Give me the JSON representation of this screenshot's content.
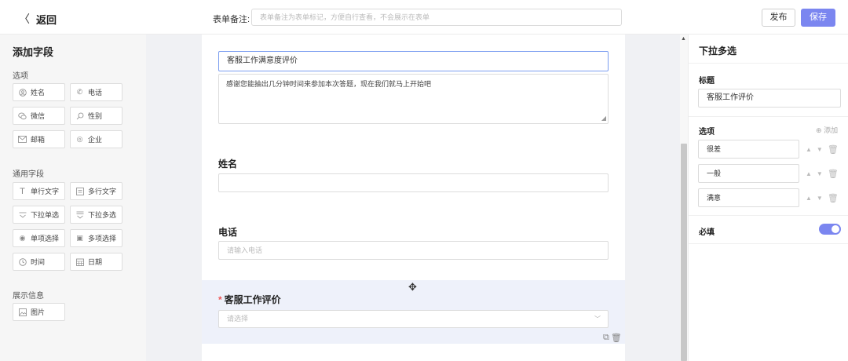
{
  "header": {
    "back_label": "返回",
    "note_label": "表单备注:",
    "note_placeholder": "表单备注为表单标记，方便自行查看，不会展示在表单",
    "publish_label": "发布",
    "save_label": "保存"
  },
  "left_panel": {
    "title": "添加字段",
    "sections": [
      {
        "label": "选项",
        "items": [
          {
            "label": "姓名",
            "icon": "user-icon"
          },
          {
            "label": "电话",
            "icon": "phone-icon"
          },
          {
            "label": "微信",
            "icon": "wechat-icon"
          },
          {
            "label": "性别",
            "icon": "gender-icon"
          },
          {
            "label": "邮箱",
            "icon": "mail-icon"
          },
          {
            "label": "企业",
            "icon": "company-icon"
          }
        ]
      },
      {
        "label": "通用字段",
        "items": [
          {
            "label": "单行文字",
            "icon": "text-icon"
          },
          {
            "label": "多行文字",
            "icon": "multiline-icon"
          },
          {
            "label": "下拉单选",
            "icon": "dropdown-icon"
          },
          {
            "label": "下拉多选",
            "icon": "dropdown-multi-icon"
          },
          {
            "label": "单项选择",
            "icon": "radio-icon"
          },
          {
            "label": "多项选择",
            "icon": "checkbox-icon"
          },
          {
            "label": "时间",
            "icon": "clock-icon"
          },
          {
            "label": "日期",
            "icon": "calendar-icon"
          }
        ]
      },
      {
        "label": "展示信息",
        "items": [
          {
            "label": "图片",
            "icon": "image-icon"
          }
        ]
      }
    ]
  },
  "form": {
    "title_value": "客服工作满意度评价",
    "description": "感谢您能抽出几分钟时间来参加本次答题，现在我们就马上开始吧",
    "fields": [
      {
        "label": "姓名",
        "placeholder": ""
      },
      {
        "label": "电话",
        "placeholder": "请输入电话"
      }
    ],
    "select_field": {
      "required_mark": "*",
      "label": "客服工作评价",
      "placeholder": "请选择"
    }
  },
  "right_panel": {
    "title": "下拉多选",
    "title_label": "标题",
    "title_value": "客服工作评价",
    "options_label": "选项",
    "add_label": "添加",
    "options": [
      "很差",
      "一般",
      "满意"
    ],
    "required_label": "必填",
    "required_on": true
  },
  "colors": {
    "accent": "#7b86f0",
    "selected_block": "#eef1fa",
    "required": "#e55555"
  }
}
